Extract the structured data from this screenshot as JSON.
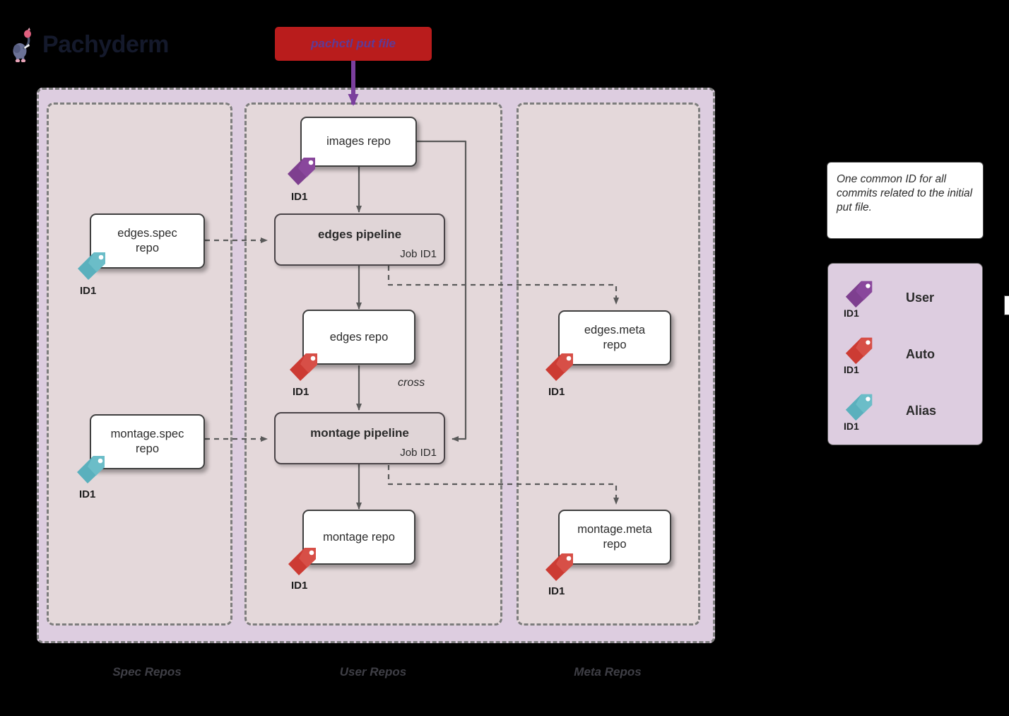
{
  "brand": {
    "name": "Pachyderm",
    "logo_icon": "pachyderm-elephant-logo-icon",
    "text_color": "#14192b"
  },
  "command": {
    "label": "pachctl put file",
    "box_color": "#b91c1c",
    "text_color": "#5f3a96",
    "arrow_color": "#7b3f9d"
  },
  "colors": {
    "outer_container": "#ddcde0",
    "column_background": "#e4d8da",
    "dashed_border": "#7d7d7d",
    "user_tag": "#7e3f8f",
    "auto_tag": "#cc3b33",
    "alias_tag": "#5ab0bd",
    "node_border": "#3f3f3f",
    "wire": "#5a5a5a"
  },
  "columns": [
    {
      "key": "spec",
      "caption": "Spec Repos"
    },
    {
      "key": "user",
      "caption": "User Repos"
    },
    {
      "key": "meta",
      "caption": "Meta Repos"
    }
  ],
  "nodes": {
    "images_repo": {
      "label": "images repo",
      "tag": "User",
      "tag_id": "ID1",
      "column": "user"
    },
    "edges_spec_repo": {
      "label": "edges.spec\nrepo",
      "tag": "Alias",
      "tag_id": "ID1",
      "column": "spec"
    },
    "montage_spec_repo": {
      "label": "montage.spec\nrepo",
      "tag": "Alias",
      "tag_id": "ID1",
      "column": "spec"
    },
    "edges_repo": {
      "label": "edges repo",
      "tag": "Auto",
      "tag_id": "ID1",
      "column": "user"
    },
    "montage_repo": {
      "label": "montage repo",
      "tag": "Auto",
      "tag_id": "ID1",
      "column": "user"
    },
    "edges_meta_repo": {
      "label": "edges.meta\nrepo",
      "tag": "Auto",
      "tag_id": "ID1",
      "column": "meta"
    },
    "montage_meta_repo": {
      "label": "montage.meta\nrepo",
      "tag": "Auto",
      "tag_id": "ID1",
      "column": "meta"
    }
  },
  "pipelines": {
    "edges": {
      "title": "edges pipeline",
      "job": "Job ID1"
    },
    "montage": {
      "title": "montage pipeline",
      "job": "Job ID1"
    }
  },
  "edge_labels": {
    "cross": "cross"
  },
  "note": {
    "text": "One common ID for all commits related to the initial put file."
  },
  "legend": {
    "items": [
      {
        "name": "User",
        "id": "ID1",
        "color": "#7e3f8f",
        "icon": "tag-icon"
      },
      {
        "name": "Auto",
        "id": "ID1",
        "color": "#cc3b33",
        "icon": "tag-icon"
      },
      {
        "name": "Alias",
        "id": "ID1",
        "color": "#5ab0bd",
        "icon": "tag-icon"
      }
    ]
  },
  "tag_ids": {
    "images": "ID1",
    "edges_spec": "ID1",
    "montage_spec": "ID1",
    "edges": "ID1",
    "montage": "ID1",
    "edges_meta": "ID1",
    "montage_meta": "ID1"
  }
}
